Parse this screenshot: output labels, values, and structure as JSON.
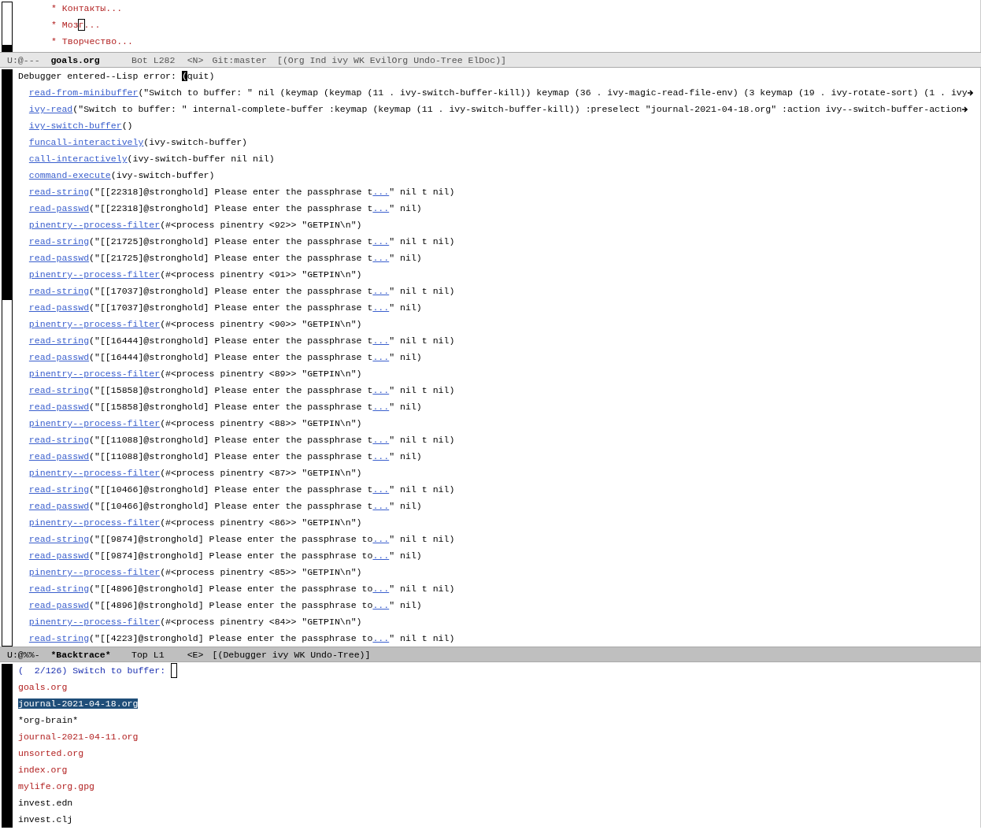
{
  "top_window": {
    "lines": [
      {
        "text": "* Контакты..."
      },
      {
        "text": "* Моз",
        "cursor": {
          "char": "г"
        },
        "rest": "..."
      },
      {
        "text": "* Творчество..."
      }
    ],
    "mode_line": {
      "active": false,
      "status": "U:@---",
      "buffer": "goals.org",
      "position": "Bot L282",
      "state": "<N>",
      "vc": "Git:master",
      "modes": "[(Org Ind ivy WK EvilOrg Undo-Tree ElDoc)]"
    }
  },
  "backtrace_window": {
    "header": {
      "text": "Debugger entered--Lisp error: ",
      "cursor": {
        "char": "("
      },
      "rest": "quit)"
    },
    "frames": [
      {
        "function": "read-from-minibuffer",
        "args": "(\"Switch to buffer: \" nil (keymap (keymap (11 . ivy-switch-buffer-kill)) keymap (36 . ivy-magic-read-file-env) (3 keymap (19 . ivy-rotate-sort) (1 . ivy",
        "truncated": true
      },
      {
        "function": "ivy-read",
        "args": "(\"Switch to buffer: \" internal-complete-buffer :keymap (keymap (11 . ivy-switch-buffer-kill)) :preselect \"journal-2021-04-18.org\" :action ivy--switch-buffer-action",
        "truncated": true
      },
      {
        "function": "ivy-switch-buffer",
        "args": "()"
      },
      {
        "function": "funcall-interactively",
        "args": "(ivy-switch-buffer)"
      },
      {
        "function": "call-interactively",
        "args": "(ivy-switch-buffer nil nil)"
      },
      {
        "function": "command-execute",
        "args": "(ivy-switch-buffer)"
      },
      {
        "function": "read-string",
        "args": "(\"[[22318]@stronghold] Please enter the passphrase t",
        "link": "...",
        "tail": "\" nil t nil)"
      },
      {
        "function": "read-passwd",
        "args": "(\"[[22318]@stronghold] Please enter the passphrase t",
        "link": "...",
        "tail": "\" nil)"
      },
      {
        "function": "pinentry--process-filter",
        "args": "(#<process pinentry <92>> \"GETPIN\\n\")"
      },
      {
        "function": "read-string",
        "args": "(\"[[21725]@stronghold] Please enter the passphrase t",
        "link": "...",
        "tail": "\" nil t nil)"
      },
      {
        "function": "read-passwd",
        "args": "(\"[[21725]@stronghold] Please enter the passphrase t",
        "link": "...",
        "tail": "\" nil)"
      },
      {
        "function": "pinentry--process-filter",
        "args": "(#<process pinentry <91>> \"GETPIN\\n\")"
      },
      {
        "function": "read-string",
        "args": "(\"[[17037]@stronghold] Please enter the passphrase t",
        "link": "...",
        "tail": "\" nil t nil)"
      },
      {
        "function": "read-passwd",
        "args": "(\"[[17037]@stronghold] Please enter the passphrase t",
        "link": "...",
        "tail": "\" nil)"
      },
      {
        "function": "pinentry--process-filter",
        "args": "(#<process pinentry <90>> \"GETPIN\\n\")"
      },
      {
        "function": "read-string",
        "args": "(\"[[16444]@stronghold] Please enter the passphrase t",
        "link": "...",
        "tail": "\" nil t nil)"
      },
      {
        "function": "read-passwd",
        "args": "(\"[[16444]@stronghold] Please enter the passphrase t",
        "link": "...",
        "tail": "\" nil)"
      },
      {
        "function": "pinentry--process-filter",
        "args": "(#<process pinentry <89>> \"GETPIN\\n\")"
      },
      {
        "function": "read-string",
        "args": "(\"[[15858]@stronghold] Please enter the passphrase t",
        "link": "...",
        "tail": "\" nil t nil)"
      },
      {
        "function": "read-passwd",
        "args": "(\"[[15858]@stronghold] Please enter the passphrase t",
        "link": "...",
        "tail": "\" nil)"
      },
      {
        "function": "pinentry--process-filter",
        "args": "(#<process pinentry <88>> \"GETPIN\\n\")"
      },
      {
        "function": "read-string",
        "args": "(\"[[11088]@stronghold] Please enter the passphrase t",
        "link": "...",
        "tail": "\" nil t nil)"
      },
      {
        "function": "read-passwd",
        "args": "(\"[[11088]@stronghold] Please enter the passphrase t",
        "link": "...",
        "tail": "\" nil)"
      },
      {
        "function": "pinentry--process-filter",
        "args": "(#<process pinentry <87>> \"GETPIN\\n\")"
      },
      {
        "function": "read-string",
        "args": "(\"[[10466]@stronghold] Please enter the passphrase t",
        "link": "...",
        "tail": "\" nil t nil)"
      },
      {
        "function": "read-passwd",
        "args": "(\"[[10466]@stronghold] Please enter the passphrase t",
        "link": "...",
        "tail": "\" nil)"
      },
      {
        "function": "pinentry--process-filter",
        "args": "(#<process pinentry <86>> \"GETPIN\\n\")"
      },
      {
        "function": "read-string",
        "args": "(\"[[9874]@stronghold] Please enter the passphrase to",
        "link": "...",
        "tail": "\" nil t nil)"
      },
      {
        "function": "read-passwd",
        "args": "(\"[[9874]@stronghold] Please enter the passphrase to",
        "link": "...",
        "tail": "\" nil)"
      },
      {
        "function": "pinentry--process-filter",
        "args": "(#<process pinentry <85>> \"GETPIN\\n\")"
      },
      {
        "function": "read-string",
        "args": "(\"[[4896]@stronghold] Please enter the passphrase to",
        "link": "...",
        "tail": "\" nil t nil)"
      },
      {
        "function": "read-passwd",
        "args": "(\"[[4896]@stronghold] Please enter the passphrase to",
        "link": "...",
        "tail": "\" nil)"
      },
      {
        "function": "pinentry--process-filter",
        "args": "(#<process pinentry <84>> \"GETPIN\\n\")"
      },
      {
        "function": "read-string",
        "args": "(\"[[4223]@stronghold] Please enter the passphrase to",
        "link": "...",
        "tail": "\" nil t nil)"
      }
    ],
    "mode_line": {
      "active": true,
      "status": "U:@%%-",
      "buffer": "*Backtrace*",
      "position": "Top L1",
      "state": "<E>",
      "modes": "[(Debugger ivy WK Undo-Tree)]"
    }
  },
  "minibuffer": {
    "prompt": "(  2/126) Switch to buffer: ",
    "candidates": [
      {
        "text": "goals.org",
        "kind": "file",
        "selected": false
      },
      {
        "text": "journal-2021-04-18.org",
        "kind": "file",
        "selected": true
      },
      {
        "text": "*org-brain*",
        "kind": "buffer",
        "selected": false
      },
      {
        "text": "journal-2021-04-11.org",
        "kind": "file",
        "selected": false
      },
      {
        "text": "unsorted.org",
        "kind": "file",
        "selected": false
      },
      {
        "text": "index.org",
        "kind": "file",
        "selected": false
      },
      {
        "text": "mylife.org.gpg",
        "kind": "file",
        "selected": false
      },
      {
        "text": "invest.edn",
        "kind": "buffer",
        "selected": false
      },
      {
        "text": "invest.clj",
        "kind": "buffer",
        "selected": false
      }
    ]
  }
}
